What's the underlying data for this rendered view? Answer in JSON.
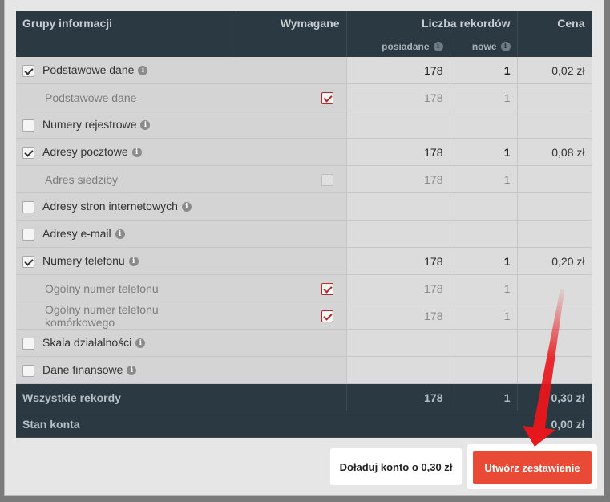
{
  "header": {
    "groups_label": "Grupy informacji",
    "required_label": "Wymagane",
    "records_label": "Liczba rekordów",
    "price_label": "Cena",
    "owned_label": "posiadane",
    "new_label": "nowe"
  },
  "rows": [
    {
      "type": "grp",
      "checked": true,
      "label": "Podstawowe dane",
      "owned": "178",
      "new": "1",
      "price": "0,02 zł"
    },
    {
      "type": "sub",
      "label": "Podstawowe dane",
      "required": "checked",
      "owned": "178",
      "new": "1"
    },
    {
      "type": "grp",
      "checked": false,
      "label": "Numery rejestrowe"
    },
    {
      "type": "grp",
      "checked": true,
      "label": "Adresy pocztowe",
      "owned": "178",
      "new": "1",
      "price": "0,08 zł"
    },
    {
      "type": "sub",
      "label": "Adres siedziby",
      "required": "unchecked",
      "owned": "178",
      "new": "1"
    },
    {
      "type": "grp",
      "checked": false,
      "label": "Adresy stron internetowych"
    },
    {
      "type": "grp",
      "checked": false,
      "label": "Adresy e-mail"
    },
    {
      "type": "grp",
      "checked": true,
      "label": "Numery telefonu",
      "owned": "178",
      "new": "1",
      "price": "0,20 zł"
    },
    {
      "type": "sub",
      "label": "Ogólny numer telefonu",
      "required": "checked",
      "owned": "178",
      "new": "1"
    },
    {
      "type": "sub",
      "label": "Ogólny numer telefonu komórkowego",
      "required": "checked",
      "owned": "178",
      "new": "1"
    },
    {
      "type": "grp",
      "checked": false,
      "label": "Skala działalności"
    },
    {
      "type": "grp",
      "checked": false,
      "label": "Dane finansowe"
    }
  ],
  "footer": {
    "all_label": "Wszystkie rekordy",
    "all_owned": "178",
    "all_new": "1",
    "all_price": "0,30 zł",
    "balance_label": "Stan konta",
    "balance_value": "0,00 zł"
  },
  "buttons": {
    "topup_label": "Doładuj konto o 0,30 zł",
    "create_label": "Utwórz zestawienie"
  },
  "colors": {
    "header_bg": "#2b3942",
    "accent_red": "#e84a35",
    "arrow_red": "#e8161b"
  },
  "icons": {
    "info": "info-icon",
    "check": "check-icon",
    "arrow": "red-arrow"
  }
}
